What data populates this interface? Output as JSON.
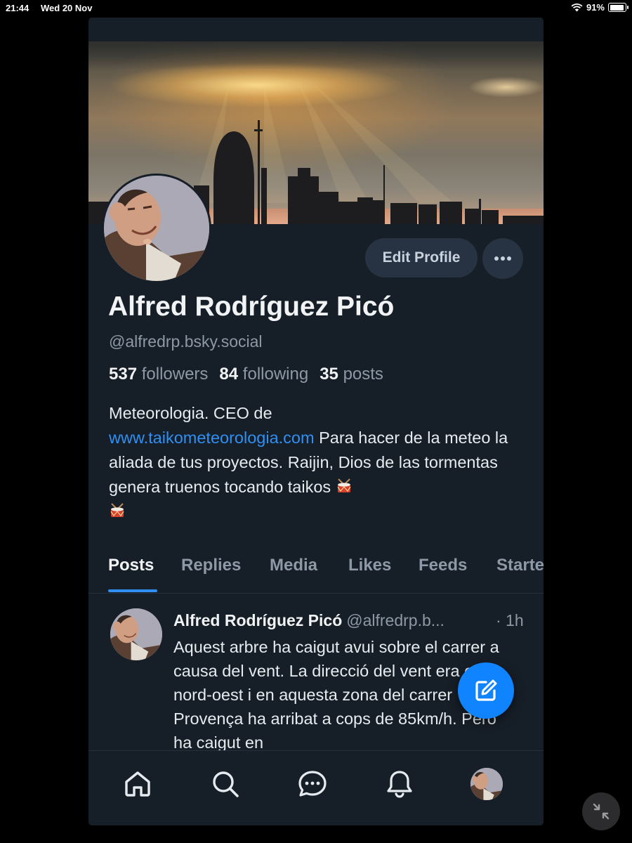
{
  "statusbar": {
    "time": "21:44",
    "date": "Wed 20 Nov",
    "battery": "91%",
    "battery_level": 0.91
  },
  "profile": {
    "name": "Alfred Rodríguez Picó",
    "handle": "@alfredrp.bsky.social",
    "edit_label": "Edit Profile",
    "stats": {
      "followers_count": "537",
      "followers_label": "followers",
      "following_count": "84",
      "following_label": "following",
      "posts_count": "35",
      "posts_label": "posts"
    },
    "bio": {
      "line1": "Meteorologia. CEO de",
      "link": "www.taikometeorologia.com",
      "rest": " Para hacer de la meteo la aliada de tus proyectos. Raijin, Dios de las tormentas genera truenos tocando taikos"
    }
  },
  "tabs": [
    "Posts",
    "Replies",
    "Media",
    "Likes",
    "Feeds",
    "Starter Packs"
  ],
  "active_tab": "Posts",
  "post": {
    "author": "Alfred Rodríguez Picó",
    "handle": "@alfredrp.b...",
    "time": "· 1h",
    "text": "Aquest arbre ha caigut avui sobre el carrer a causa del vent. La direcció del vent era oest-nord-oest i en aquesta zona del carrer Provença ha arribat a cops de 85km/h. Però ha caigut en"
  },
  "icons": {
    "more": "ellipsis-icon",
    "compose": "compose-icon",
    "home": "home-icon",
    "search": "search-icon",
    "chat": "chat-icon",
    "notifications": "bell-icon",
    "minimize": "minimize-arrows-icon",
    "drum": "drum-emoji-icon"
  },
  "colors": {
    "background": "#161e27",
    "accent": "#2f8ff2",
    "fab": "#1083fe",
    "muted": "#8d99a6"
  }
}
